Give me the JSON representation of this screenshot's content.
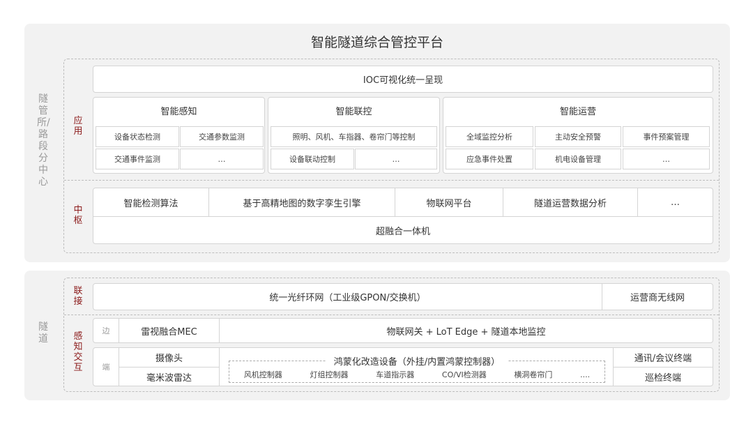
{
  "title": "智能隧道综合管控平台",
  "top": {
    "side_label": "隧管所/路段分中心",
    "app_label": "应用",
    "hub_label": "中枢",
    "ioc": "IOC可视化统一呈现",
    "perception": {
      "title": "智能感知",
      "cells": [
        "设备状态检测",
        "交通参数监测",
        "交通事件监测",
        "…"
      ]
    },
    "control": {
      "title": "智能联控",
      "cells": [
        "照明、风机、车指器、卷帘门等控制",
        "设备联动控制",
        "…"
      ]
    },
    "operation": {
      "title": "智能运营",
      "cells": [
        "全域监控分析",
        "主动安全预警",
        "事件预案管理",
        "应急事件处置",
        "机电设备管理",
        "…"
      ]
    },
    "hub_items": [
      "智能检测算法",
      "基于高精地图的数字孪生引擎",
      "物联网平台",
      "隧道运营数据分析",
      "…"
    ],
    "hub_bottom": "超融合一体机"
  },
  "bottom": {
    "side_label": "隧道",
    "link_label": "联接",
    "sense_label": "感知交互",
    "edge_label": "边",
    "end_label": "端",
    "link_main": "统一光纤环网（工业级GPON/交换机）",
    "link_side": "运营商无线网",
    "edge_left": "雷视融合MEC",
    "edge_right": "物联网关 + LoT Edge + 隧道本地监控",
    "end_left": [
      "摄像头",
      "毫米波雷达"
    ],
    "harmony_title": "鸿蒙化改造设备（外挂/内置鸿蒙控制器）",
    "harmony_items": [
      "风机控制器",
      "灯组控制器",
      "车道指示器",
      "CO/VI检测器",
      "横洞卷帘门",
      "...."
    ],
    "end_right": [
      "通讯/会议终端",
      "巡检终端"
    ]
  }
}
